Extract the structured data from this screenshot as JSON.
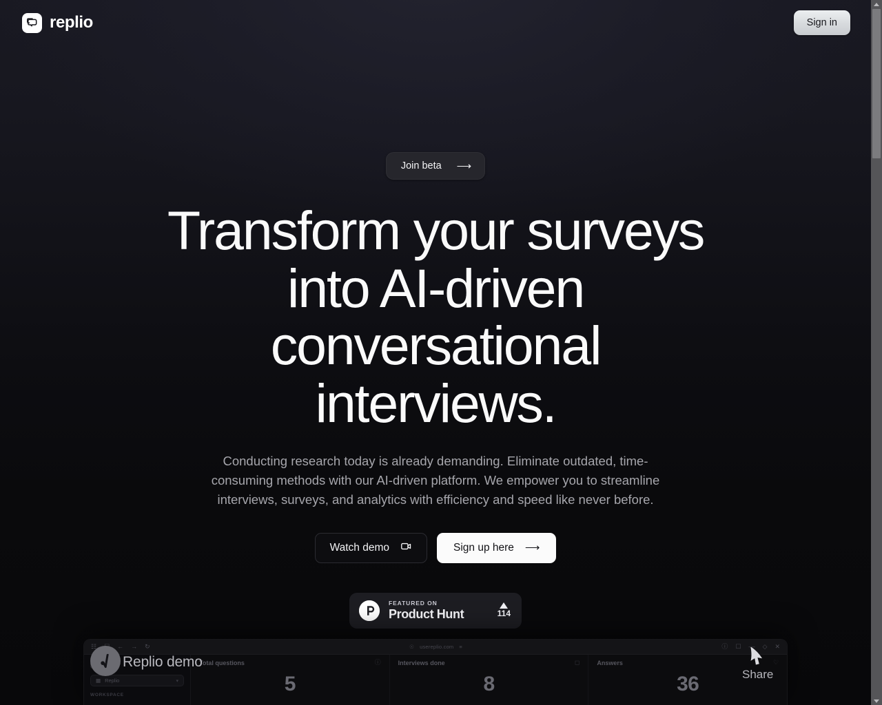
{
  "brand": {
    "name": "replio",
    "logo_icon": "chat-bubble-icon"
  },
  "nav": {
    "signin_label": "Sign in"
  },
  "hero": {
    "pill_label": "Join beta",
    "pill_icon": "arrow-right-icon",
    "headline": "Transform your surveys into AI-driven conversational interviews.",
    "subhead": "Conducting research today is already demanding. Eliminate outdated, time-consuming methods with our AI-driven platform. We empower you to streamline interviews, surveys, and analytics with efficiency and speed like never before.",
    "cta_demo_label": "Watch demo",
    "cta_demo_icon": "video-camera-icon",
    "cta_signup_label": "Sign up here",
    "cta_signup_icon": "arrow-right-icon"
  },
  "product_hunt": {
    "featured_label": "FEATURED ON",
    "name": "Product Hunt",
    "logo_letter": "P",
    "upvote_icon": "caret-up-icon",
    "upvote_count": "114"
  },
  "preview": {
    "url": "usereplio.com",
    "overlay_title": "Replio demo",
    "overlay_share_label": "Share",
    "overlay_cursor_icon": "cursor-arrow-icon",
    "sidebar": {
      "brand": "Replio",
      "workspace_value": "Replio",
      "workspace_icon": "building-icon",
      "chevron_icon": "chevron-down-icon",
      "section_label": "WORKSPACE"
    },
    "cards": [
      {
        "title": "Total questions",
        "value": "5",
        "icon": "question-circle-icon"
      },
      {
        "title": "Interviews done",
        "value": "8",
        "icon": "inbox-icon"
      },
      {
        "title": "Answers",
        "value": "36",
        "icon": "message-heart-icon"
      }
    ],
    "chrome_icons": [
      "sidebar-icon",
      "back-arrow-icon",
      "forward-arrow-icon",
      "reload-icon"
    ],
    "window_icons": [
      "info-icon",
      "panel-icon",
      "minimize-icon",
      "maximize-icon",
      "close-icon"
    ]
  },
  "scrollbar": {
    "up_icon": "scroll-up-arrow-icon",
    "down_icon": "scroll-down-arrow-icon"
  },
  "colors": {
    "background_top": "#191922",
    "background_bottom": "#08080a",
    "accent_light": "#fbfbfb",
    "text_muted": "#a6a6ac"
  }
}
